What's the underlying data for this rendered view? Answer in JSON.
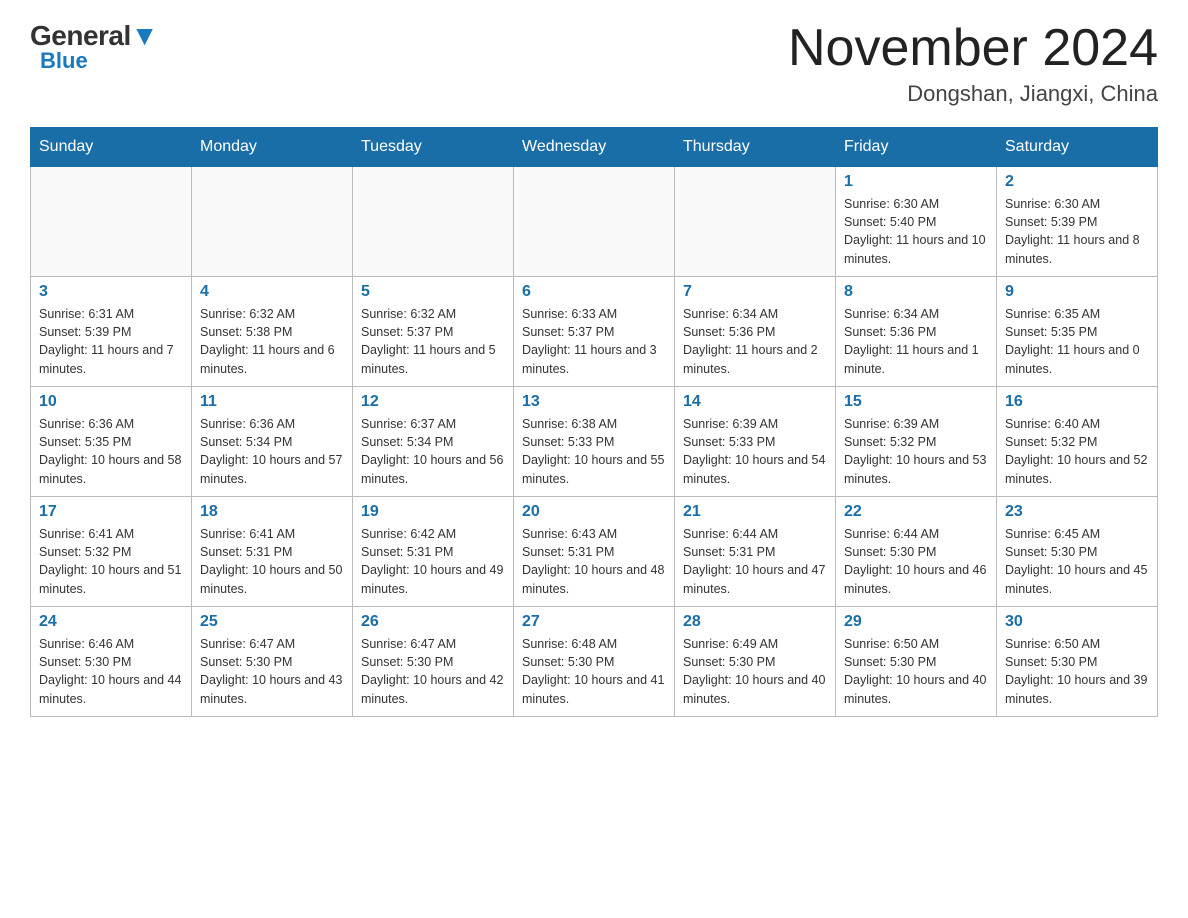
{
  "header": {
    "logo_general": "General",
    "logo_blue": "Blue",
    "month_year": "November 2024",
    "location": "Dongshan, Jiangxi, China"
  },
  "days_of_week": [
    "Sunday",
    "Monday",
    "Tuesday",
    "Wednesday",
    "Thursday",
    "Friday",
    "Saturday"
  ],
  "weeks": [
    [
      {
        "day": "",
        "info": ""
      },
      {
        "day": "",
        "info": ""
      },
      {
        "day": "",
        "info": ""
      },
      {
        "day": "",
        "info": ""
      },
      {
        "day": "",
        "info": ""
      },
      {
        "day": "1",
        "info": "Sunrise: 6:30 AM\nSunset: 5:40 PM\nDaylight: 11 hours and 10 minutes."
      },
      {
        "day": "2",
        "info": "Sunrise: 6:30 AM\nSunset: 5:39 PM\nDaylight: 11 hours and 8 minutes."
      }
    ],
    [
      {
        "day": "3",
        "info": "Sunrise: 6:31 AM\nSunset: 5:39 PM\nDaylight: 11 hours and 7 minutes."
      },
      {
        "day": "4",
        "info": "Sunrise: 6:32 AM\nSunset: 5:38 PM\nDaylight: 11 hours and 6 minutes."
      },
      {
        "day": "5",
        "info": "Sunrise: 6:32 AM\nSunset: 5:37 PM\nDaylight: 11 hours and 5 minutes."
      },
      {
        "day": "6",
        "info": "Sunrise: 6:33 AM\nSunset: 5:37 PM\nDaylight: 11 hours and 3 minutes."
      },
      {
        "day": "7",
        "info": "Sunrise: 6:34 AM\nSunset: 5:36 PM\nDaylight: 11 hours and 2 minutes."
      },
      {
        "day": "8",
        "info": "Sunrise: 6:34 AM\nSunset: 5:36 PM\nDaylight: 11 hours and 1 minute."
      },
      {
        "day": "9",
        "info": "Sunrise: 6:35 AM\nSunset: 5:35 PM\nDaylight: 11 hours and 0 minutes."
      }
    ],
    [
      {
        "day": "10",
        "info": "Sunrise: 6:36 AM\nSunset: 5:35 PM\nDaylight: 10 hours and 58 minutes."
      },
      {
        "day": "11",
        "info": "Sunrise: 6:36 AM\nSunset: 5:34 PM\nDaylight: 10 hours and 57 minutes."
      },
      {
        "day": "12",
        "info": "Sunrise: 6:37 AM\nSunset: 5:34 PM\nDaylight: 10 hours and 56 minutes."
      },
      {
        "day": "13",
        "info": "Sunrise: 6:38 AM\nSunset: 5:33 PM\nDaylight: 10 hours and 55 minutes."
      },
      {
        "day": "14",
        "info": "Sunrise: 6:39 AM\nSunset: 5:33 PM\nDaylight: 10 hours and 54 minutes."
      },
      {
        "day": "15",
        "info": "Sunrise: 6:39 AM\nSunset: 5:32 PM\nDaylight: 10 hours and 53 minutes."
      },
      {
        "day": "16",
        "info": "Sunrise: 6:40 AM\nSunset: 5:32 PM\nDaylight: 10 hours and 52 minutes."
      }
    ],
    [
      {
        "day": "17",
        "info": "Sunrise: 6:41 AM\nSunset: 5:32 PM\nDaylight: 10 hours and 51 minutes."
      },
      {
        "day": "18",
        "info": "Sunrise: 6:41 AM\nSunset: 5:31 PM\nDaylight: 10 hours and 50 minutes."
      },
      {
        "day": "19",
        "info": "Sunrise: 6:42 AM\nSunset: 5:31 PM\nDaylight: 10 hours and 49 minutes."
      },
      {
        "day": "20",
        "info": "Sunrise: 6:43 AM\nSunset: 5:31 PM\nDaylight: 10 hours and 48 minutes."
      },
      {
        "day": "21",
        "info": "Sunrise: 6:44 AM\nSunset: 5:31 PM\nDaylight: 10 hours and 47 minutes."
      },
      {
        "day": "22",
        "info": "Sunrise: 6:44 AM\nSunset: 5:30 PM\nDaylight: 10 hours and 46 minutes."
      },
      {
        "day": "23",
        "info": "Sunrise: 6:45 AM\nSunset: 5:30 PM\nDaylight: 10 hours and 45 minutes."
      }
    ],
    [
      {
        "day": "24",
        "info": "Sunrise: 6:46 AM\nSunset: 5:30 PM\nDaylight: 10 hours and 44 minutes."
      },
      {
        "day": "25",
        "info": "Sunrise: 6:47 AM\nSunset: 5:30 PM\nDaylight: 10 hours and 43 minutes."
      },
      {
        "day": "26",
        "info": "Sunrise: 6:47 AM\nSunset: 5:30 PM\nDaylight: 10 hours and 42 minutes."
      },
      {
        "day": "27",
        "info": "Sunrise: 6:48 AM\nSunset: 5:30 PM\nDaylight: 10 hours and 41 minutes."
      },
      {
        "day": "28",
        "info": "Sunrise: 6:49 AM\nSunset: 5:30 PM\nDaylight: 10 hours and 40 minutes."
      },
      {
        "day": "29",
        "info": "Sunrise: 6:50 AM\nSunset: 5:30 PM\nDaylight: 10 hours and 40 minutes."
      },
      {
        "day": "30",
        "info": "Sunrise: 6:50 AM\nSunset: 5:30 PM\nDaylight: 10 hours and 39 minutes."
      }
    ]
  ]
}
